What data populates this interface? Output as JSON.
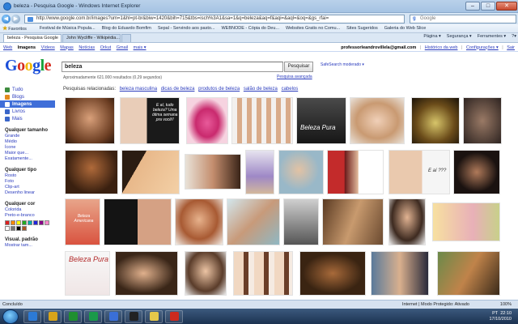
{
  "window": {
    "title": "beleza - Pesquisa Google - Windows Internet Explorer",
    "min": "–",
    "max": "□",
    "close": "✕"
  },
  "address": {
    "url": "http://www.google.com.br/images?um=1&hl=pt-br&biw=1420&bih=715&tbs=isch%3A1&sa=1&q=beleza&aq=f&aqi=&aql=&oq=&gs_rfai=",
    "search_placeholder": "Google"
  },
  "favorites": {
    "label": "Favoritos",
    "items": [
      "Festival de Música Popula...",
      "Blog do Eduardo Bomfim",
      "Sepal - Servindo aos pasto...",
      "WEBNODE - Cópia do Deu...",
      "Websites Gratis no Comu...",
      "Sites Sugeridos",
      "Galeria do Web Slice"
    ]
  },
  "tabs": [
    {
      "label": "beleza - Pesquisa Google",
      "active": true
    },
    {
      "label": "John Wycliffe - Wikipédia...",
      "active": false
    },
    {
      "label": "",
      "active": false
    }
  ],
  "commands": [
    "Página ▾",
    "Segurança ▾",
    "Ferramentes ▾",
    "?▾"
  ],
  "gbar": {
    "links": [
      "Web",
      "Imagens",
      "Vídeos",
      "Mapas",
      "Notícias",
      "Orkut",
      "Gmail",
      "mais ▾"
    ],
    "current": "Imagens",
    "email": "professorleandrovillela@gmail.com",
    "right": [
      "|",
      "Histórico da web",
      "|",
      "Configurações ▾",
      "|",
      "Sair"
    ]
  },
  "logo": {
    "letters": [
      "G",
      "o",
      "o",
      "g",
      "l",
      "e"
    ]
  },
  "search": {
    "query": "beleza",
    "button": "Pesquisar",
    "safesearch": "SafeSearch moderado ▾",
    "advanced": "Pesquisa avançada",
    "stats": "Aproximadamente 621.000 resultados (0,29 segundos)"
  },
  "related": {
    "label": "Pesquisas relacionadas:",
    "items": [
      "beleza masculina",
      "dicas de beleza",
      "produtos de beleza",
      "salão de beleza",
      "cabelos"
    ]
  },
  "sidebar": {
    "items": [
      {
        "label": "Tudo",
        "color": "#3f8c3f"
      },
      {
        "label": "Blogs",
        "color": "#e28a1d"
      },
      {
        "label": "Imagens",
        "color": "#ffffff"
      },
      {
        "label": "Livros",
        "color": "#3a66c9"
      },
      {
        "label": "Mais",
        "color": "#3a66c9"
      }
    ],
    "current": "Imagens",
    "size_head": "Qualquer tamanho",
    "sizes": [
      "Grande",
      "Médio",
      "Ícone",
      "Maior que...",
      "Exatamente..."
    ],
    "type_head": "Qualquer tipo",
    "types": [
      "Rosto",
      "Foto",
      "Clip-art",
      "Desenho linear"
    ],
    "color_head": "Qualquer cor",
    "colors": [
      "Colorida",
      "Preto-e-branco"
    ],
    "swatches": [
      "#d22",
      "#f80",
      "#ff0",
      "#2a2",
      "#0aa",
      "#22d",
      "#808",
      "#f8c",
      "#fff",
      "#777",
      "#000",
      "#a52"
    ],
    "view_head": "Visual. padrão",
    "view_link": "Mostrar tam..."
  },
  "thumbs": {
    "caption1": "E aí, tudo beleza? Uma ótima semana pra você!!",
    "caption2": "E aí ???",
    "caption3": "Beleza Pura",
    "caption4": "Beleza Americana",
    "caption5": "Beleza Pura"
  },
  "status": {
    "left": "Concluído",
    "mid": "Internet | Modo Protegido: Ativado",
    "zoom": "100%"
  },
  "taskbar": {
    "lang": "PT",
    "time": "22:10",
    "date": "17/10/2010",
    "apps": [
      "#2c7ad6",
      "#d8a41a",
      "#1f8f2f",
      "#1a9a4a",
      "#3a6fd8",
      "#222",
      "#e6c84a",
      "#cc2a1e"
    ]
  }
}
